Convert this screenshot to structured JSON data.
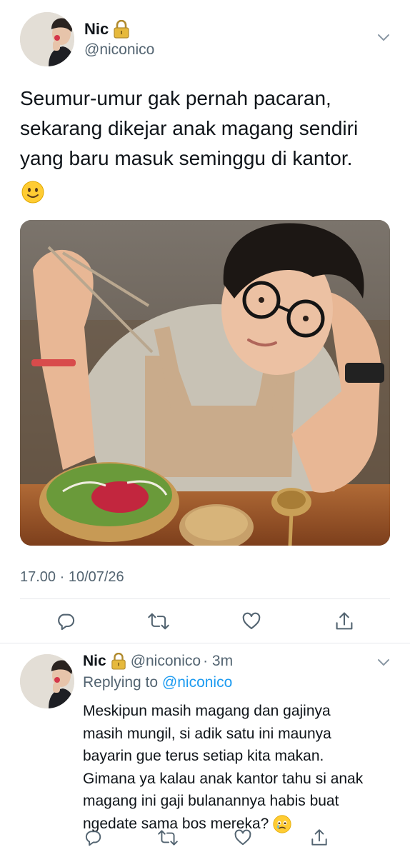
{
  "main_tweet": {
    "display_name": "Nic",
    "handle": "@niconico",
    "text_line1": "Seumur-umur gak pernah pacaran,",
    "text_line2": "sekarang dikejar anak magang sendiri",
    "text_line3": "yang baru masuk seminggu di kantor.",
    "timestamp": "17.00 · 10/07/26"
  },
  "reply_tweet": {
    "display_name": "Nic",
    "handle": "@niconico",
    "time": "· 3m",
    "replying_label": "Replying to",
    "replying_handle": "@niconico",
    "lines": [
      "Meskipun masih magang dan gajinya",
      "masih mungil, si adik satu ini maunya",
      "bayarin gue terus setiap kita makan.",
      "Gimana ya kalau anak kantor tahu si anak",
      "magang ini gaji bulanannya habis buat",
      "ngedate sama bos mereka?"
    ]
  },
  "icons": {
    "lock": "lock-icon",
    "caret": "chevron-down-icon",
    "reply": "reply-icon",
    "retweet": "retweet-icon",
    "like": "heart-icon",
    "share": "share-icon"
  },
  "colors": {
    "link": "#1d9bf0",
    "secondary_text": "#536471",
    "lock": "#c9a227"
  }
}
